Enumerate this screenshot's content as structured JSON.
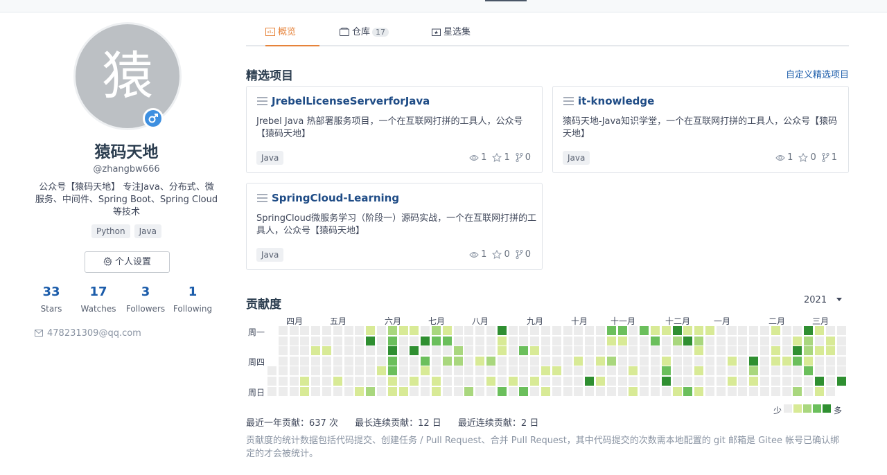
{
  "profile": {
    "avatar_char": "猿",
    "name": "猿码天地",
    "login": "@zhangbw666",
    "bio": "公众号【猿码天地】 专注Java、分布式、微服务、中间件、Spring Boot、Spring Cloud等技术",
    "tags": [
      "Python",
      "Java"
    ],
    "settings_label": "个人设置",
    "stats": [
      {
        "num": "33",
        "label": "Stars"
      },
      {
        "num": "17",
        "label": "Watches"
      },
      {
        "num": "3",
        "label": "Followers"
      },
      {
        "num": "1",
        "label": "Following"
      }
    ],
    "email": "478231309@qq.com"
  },
  "tabs": [
    {
      "label": "概览",
      "icon": "overview-icon",
      "active": true
    },
    {
      "label": "仓库",
      "icon": "repo-icon",
      "count": "17"
    },
    {
      "label": "星选集",
      "icon": "star-collection-icon"
    }
  ],
  "featured": {
    "title": "精选项目",
    "customize_label": "自定义精选项目",
    "projects": [
      {
        "name": "JrebelLicenseServerforJava",
        "desc": "Jrebel Java 热部署服务项目，一个在互联网打拼的工具人，公众号【猿码天地】",
        "lang": "Java",
        "watch": "1",
        "star": "1",
        "fork": "0"
      },
      {
        "name": "it-knowledge",
        "desc": "猿码天地-Java知识学堂，一个在互联网打拼的工具人，公众号【猿码天地】",
        "lang": "Java",
        "watch": "1",
        "star": "0",
        "fork": "1"
      },
      {
        "name": "SpringCloud-Learning",
        "desc": "SpringCloud微服务学习（阶段一）源码实战，一个在互联网打拼的工具人，公众号【猿码天地】",
        "lang": "Java",
        "watch": "1",
        "star": "0",
        "fork": "0"
      }
    ]
  },
  "contrib": {
    "title": "贡献度",
    "year": "2021",
    "months": [
      "四月",
      "五月",
      "六月",
      "七月",
      "八月",
      "九月",
      "十月",
      "十一月",
      "十二月",
      "一月",
      "二月",
      "三月"
    ],
    "days": [
      "周一",
      "周四",
      "周日"
    ],
    "legend_less": "少",
    "legend_more": "多",
    "summary": [
      "最近一年贡献：637 次",
      "最长连续贡献：12 日",
      "最近连续贡献：2 日"
    ],
    "note": "贡献度的统计数据包括代码提交、创建任务 / Pull Request、合并 Pull Request，其中代码提交的次数需本地配置的 git 邮箱是 Gitee 帐号已确认绑定的才会被统计。",
    "colors": [
      "#ececec",
      "#d8ea96",
      "#a9d77e",
      "#6bbf5c",
      "#2f8f31"
    ]
  }
}
